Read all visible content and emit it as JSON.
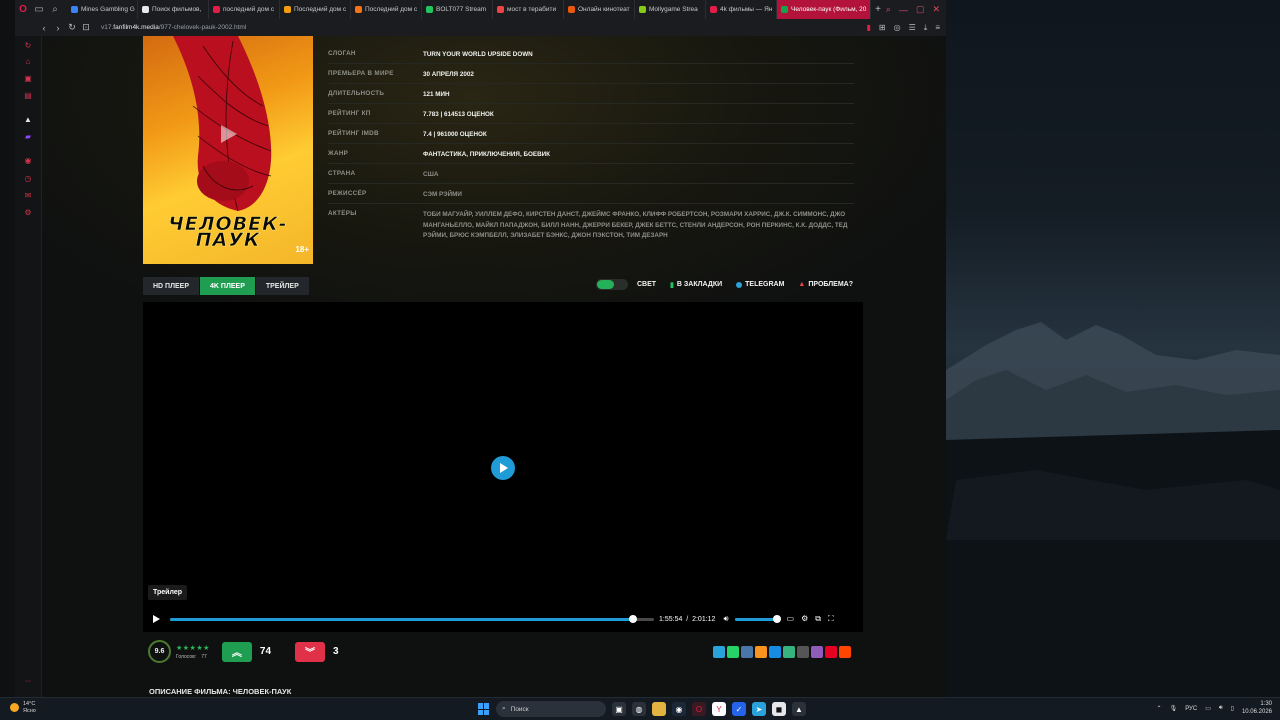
{
  "browser": {
    "tabs": [
      {
        "label": "Mines Gambling G",
        "color": "#3b82f6"
      },
      {
        "label": "Поиск фильмов,",
        "color": "#e5e7eb"
      },
      {
        "label": "последний дом с",
        "color": "#e11d48"
      },
      {
        "label": "Последний дом с",
        "color": "#f59e0b"
      },
      {
        "label": "Последний дом с",
        "color": "#f97316"
      },
      {
        "label": "BOLT077 Stream",
        "color": "#22c55e"
      },
      {
        "label": "мост в терабити",
        "color": "#ef4444"
      },
      {
        "label": "Онлайн кинотеат",
        "color": "#ea580c"
      },
      {
        "label": "Mollygame Strea",
        "color": "#84cc16"
      },
      {
        "label": "4k фильмы — Ян",
        "color": "#e11d48"
      },
      {
        "label": "Человек-паук (Фильм, 20",
        "color": "#16a34a"
      }
    ],
    "url_prefix": "v17.",
    "url_domain": "fanfilm4k.media",
    "url_path": "/977-chelovek-pauk-2002.html"
  },
  "movie": {
    "poster_title": "ЧЕЛОВЕК-ПАУК",
    "age": "18+",
    "info": [
      {
        "key": "СЛОГАН",
        "value": "TURN YOUR WORLD UPSIDE DOWN"
      },
      {
        "key": "ПРЕМЬЕРА В МИРЕ",
        "value": "30 АПРЕЛЯ 2002"
      },
      {
        "key": "ДЛИТЕЛЬНОСТЬ",
        "value": "121 МИН"
      },
      {
        "key": "РЕЙТИНГ КП",
        "value": "7.783 | 614513 ОЦЕНОК"
      },
      {
        "key": "РЕЙТИНГ IMDB",
        "value": "7.4 | 961000 ОЦЕНОК"
      },
      {
        "key": "ЖАНР",
        "value": "ФАНТАСТИКА, ПРИКЛЮЧЕНИЯ, БОЕВИК"
      },
      {
        "key": "СТРАНА",
        "value": "США"
      },
      {
        "key": "РЕЖИССЁР",
        "value": "СЭМ РЭЙМИ"
      },
      {
        "key": "АКТЁРЫ",
        "value": "ТОБИ МАГУАЙР, УИЛЛЕМ ДЕФО, КИРСТЕН ДАНСТ, ДЖЕЙМС ФРАНКО, КЛИФФ РОБЕРТСОН, РОЗМАРИ ХАРРИС, ДЖ.К. СИММОНС, ДЖО МАНГАНЬЕЛЛО, МАЙКЛ ПАПАДЖОН, БИЛЛ НАНН, ДЖЕРРИ БЕКЕР, ДЖЕК БЕТТС, СТЕНЛИ АНДЕРСОН, РОН ПЕРКИНС, К.К. ДОДДС, ТЕД РЭЙМИ, БРЮС КЭМПБЕЛЛ, ЭЛИЗАБЕТ БЭНКС, ДЖОН ПЭКСТОН, ТИМ ДЕЗАРН"
      }
    ]
  },
  "player_tabs": [
    "HD ПЛЕЕР",
    "4K ПЛЕЕР",
    "ТРЕЙЛЕР"
  ],
  "actions": {
    "light": "СВЕТ",
    "bookmarks": "В ЗАКЛАДКИ",
    "telegram": "TELEGRAM",
    "problem": "ПРОБЛЕМА?"
  },
  "player": {
    "tooltip": "Трейлер",
    "current_time": "1:55:54",
    "separator": "/",
    "duration": "2:01:12",
    "progress": 0.956,
    "volume": 1.0
  },
  "rating": {
    "score": "9.6",
    "votes_label": "Голосов:",
    "votes": "77",
    "likes": "74",
    "dislikes": "3"
  },
  "share_colors": [
    "#2aa3db",
    "#25d366",
    "#4a76a8",
    "#f7931e",
    "#168de2",
    "#36b37e",
    "#555555",
    "#8f5db7",
    "#e60023",
    "#ff4500"
  ],
  "description_title": "ОПИСАНИЕ ФИЛЬМА: ЧЕЛОВЕК-ПАУК",
  "taskbar": {
    "temp": "14°C",
    "weather": "Ясно",
    "search": "Поиск",
    "lang": "РУС",
    "time": "1:30",
    "date": "10.06.2026"
  }
}
